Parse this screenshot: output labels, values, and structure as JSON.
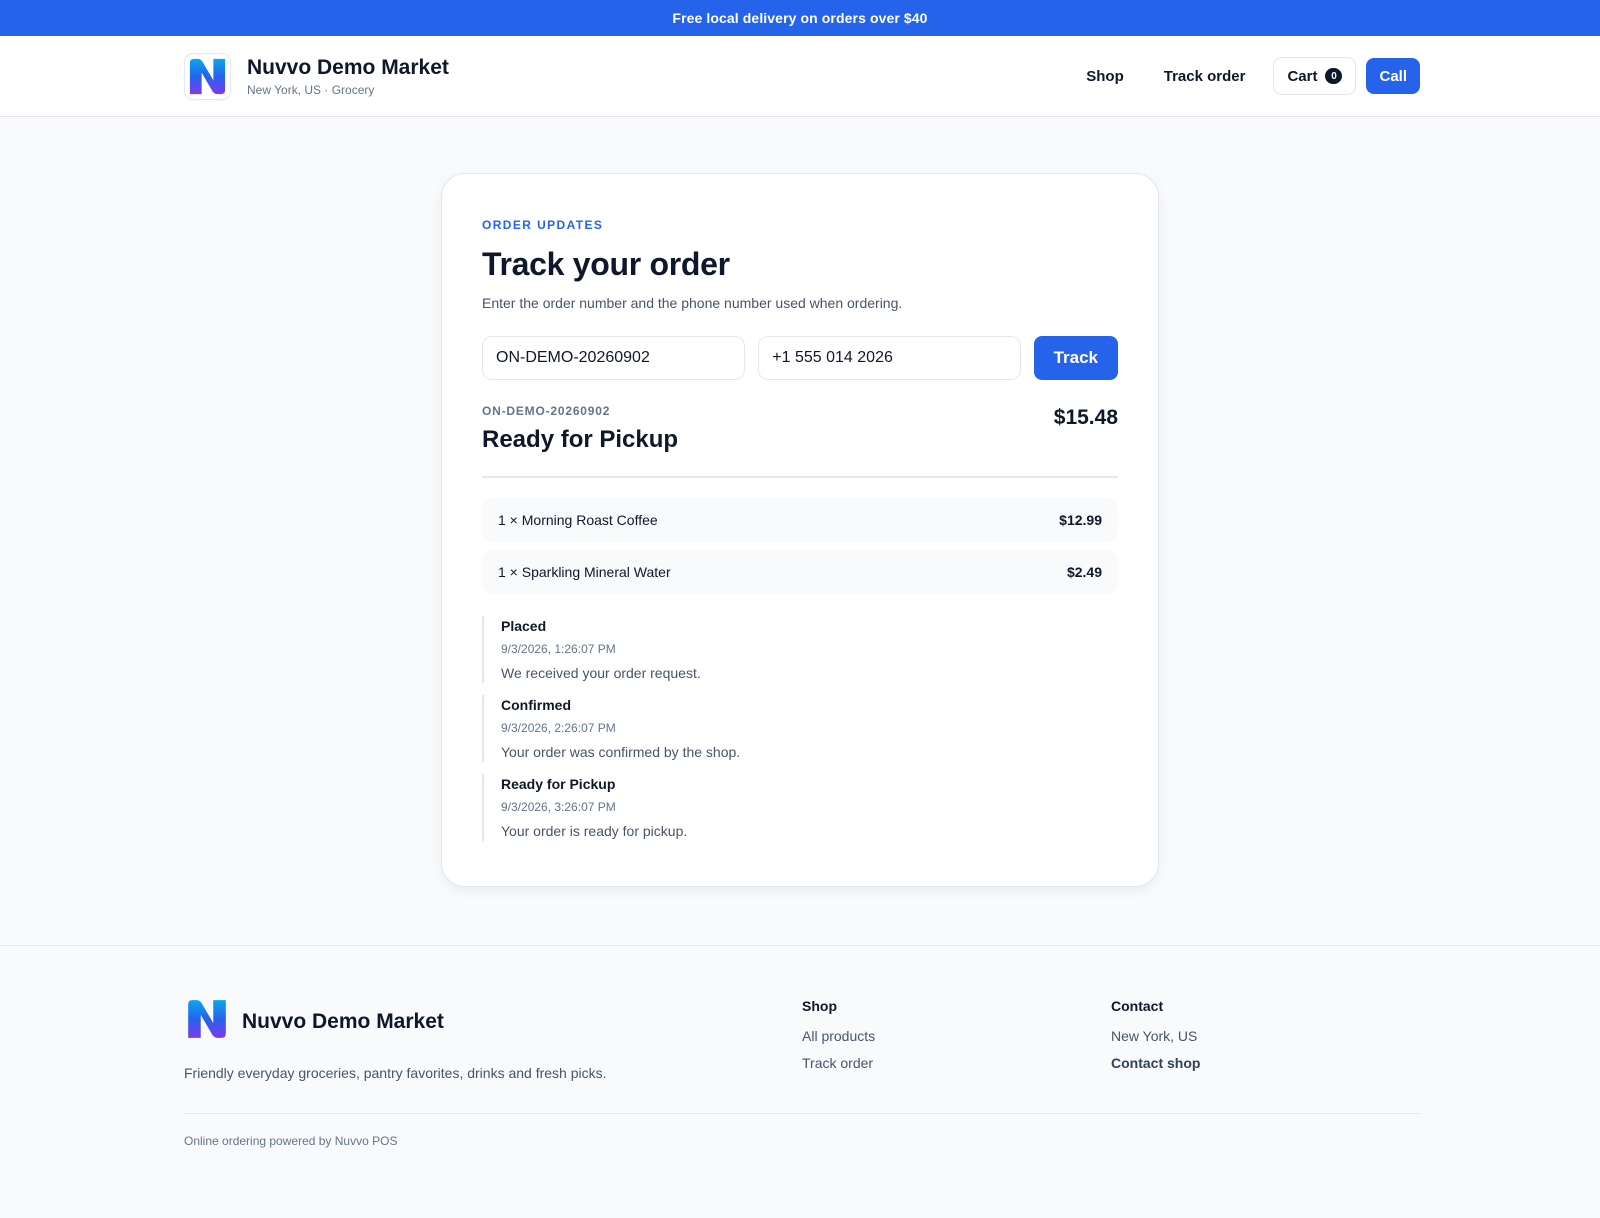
{
  "announcement": "Free local delivery on orders over $40",
  "header": {
    "brand_name": "Nuvvo Demo Market",
    "brand_sub": "New York, US · Grocery",
    "nav": {
      "shop": "Shop",
      "track_order": "Track order",
      "cart_label": "Cart",
      "cart_count": "0",
      "call": "Call"
    }
  },
  "tracker": {
    "eyebrow": "ORDER UPDATES",
    "title": "Track your order",
    "subtitle": "Enter the order number and the phone number used when ordering.",
    "order_number_value": "ON-DEMO-20260902",
    "phone_value": "+1 555 014 2026",
    "track_button": "Track"
  },
  "order": {
    "id": "ON-DEMO-20260902",
    "status": "Ready for Pickup",
    "total": "$15.48",
    "items": [
      {
        "label": "1 × Morning Roast Coffee",
        "price": "$12.99"
      },
      {
        "label": "1 × Sparkling Mineral Water",
        "price": "$2.49"
      }
    ],
    "timeline": [
      {
        "title": "Placed",
        "time": "9/3/2026, 1:26:07 PM",
        "desc": "We received your order request."
      },
      {
        "title": "Confirmed",
        "time": "9/3/2026, 2:26:07 PM",
        "desc": "Your order was confirmed by the shop."
      },
      {
        "title": "Ready for Pickup",
        "time": "9/3/2026, 3:26:07 PM",
        "desc": "Your order is ready for pickup."
      }
    ]
  },
  "footer": {
    "brand_name": "Nuvvo Demo Market",
    "description": "Friendly everyday groceries, pantry favorites, drinks and fresh picks.",
    "shop_heading": "Shop",
    "shop_links": [
      "All products",
      "Track order"
    ],
    "contact_heading": "Contact",
    "contact_location": "New York, US",
    "contact_link": "Contact shop",
    "powered_by": "Online ordering powered by Nuvvo POS"
  },
  "colors": {
    "accent": "#2563eb",
    "text": "#0f172a",
    "muted": "#64748b",
    "background": "#f8fafc"
  },
  "icons": {
    "logo": "nuvvo-n-logo-icon"
  }
}
